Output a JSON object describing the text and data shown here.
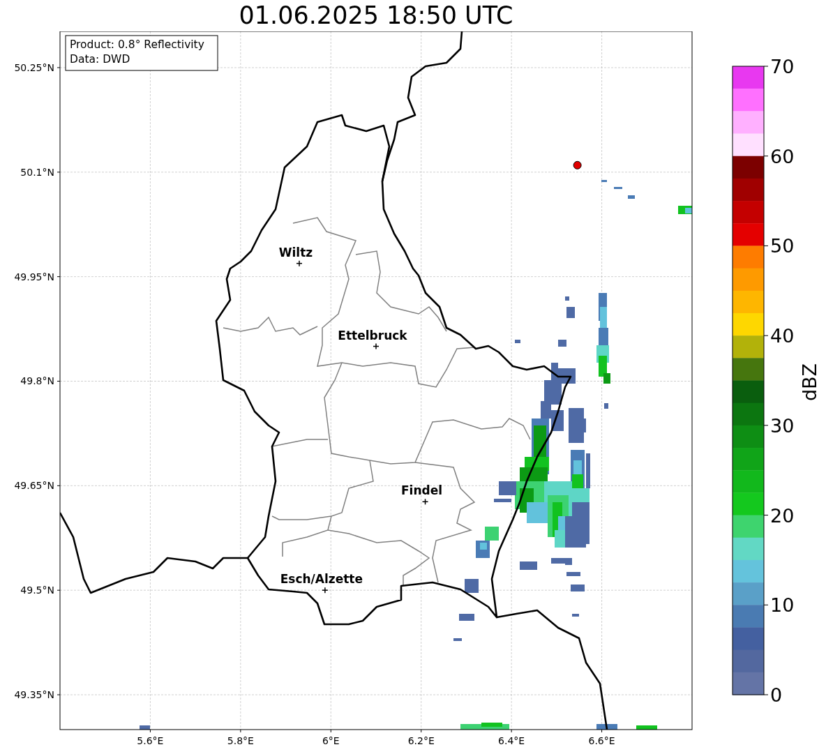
{
  "map": {
    "title": "01.06.2025 18:50 UTC",
    "info_lines": [
      "Product: 0.8° Reflectivity",
      "Data: DWD"
    ],
    "y_tick_labels": [
      "50.25°N",
      "50.1°N",
      "49.95°N",
      "49.8°N",
      "49.65°N",
      "49.5°N",
      "49.35°N"
    ],
    "x_tick_labels": [
      "5.6°E",
      "5.8°E",
      "6°E",
      "6.2°E",
      "6.4°E",
      "6.6°E"
    ],
    "cities": [
      {
        "name": "Wiltz"
      },
      {
        "name": "Ettelbruck"
      },
      {
        "name": "Findel"
      },
      {
        "name": "Esch/Alzette"
      }
    ]
  },
  "colorbar": {
    "label": "dBZ",
    "ticks": [
      "70",
      "60",
      "50",
      "40",
      "30",
      "20",
      "10",
      "0"
    ],
    "bins": [
      {
        "color": "#e838f0"
      },
      {
        "color": "#ff70ff"
      },
      {
        "color": "#ffb0ff"
      },
      {
        "color": "#ffe0ff"
      },
      {
        "color": "#7c0000"
      },
      {
        "color": "#a00000"
      },
      {
        "color": "#c40000"
      },
      {
        "color": "#e40000"
      },
      {
        "color": "#fe7c00"
      },
      {
        "color": "#fe9a00"
      },
      {
        "color": "#feb600"
      },
      {
        "color": "#fed700"
      },
      {
        "color": "#b2b20a"
      },
      {
        "color": "#46760e"
      },
      {
        "color": "#0a5e0e"
      },
      {
        "color": "#0c7610"
      },
      {
        "color": "#0e8e14"
      },
      {
        "color": "#10a418"
      },
      {
        "color": "#12b81c"
      },
      {
        "color": "#14c81e"
      },
      {
        "color": "#3ed46e"
      },
      {
        "color": "#62d8c4"
      },
      {
        "color": "#64c3dc"
      },
      {
        "color": "#5aa0c8"
      },
      {
        "color": "#4a7bb2"
      },
      {
        "color": "#4460a0"
      },
      {
        "color": "#53689f"
      },
      {
        "color": "#6474a6"
      }
    ]
  }
}
